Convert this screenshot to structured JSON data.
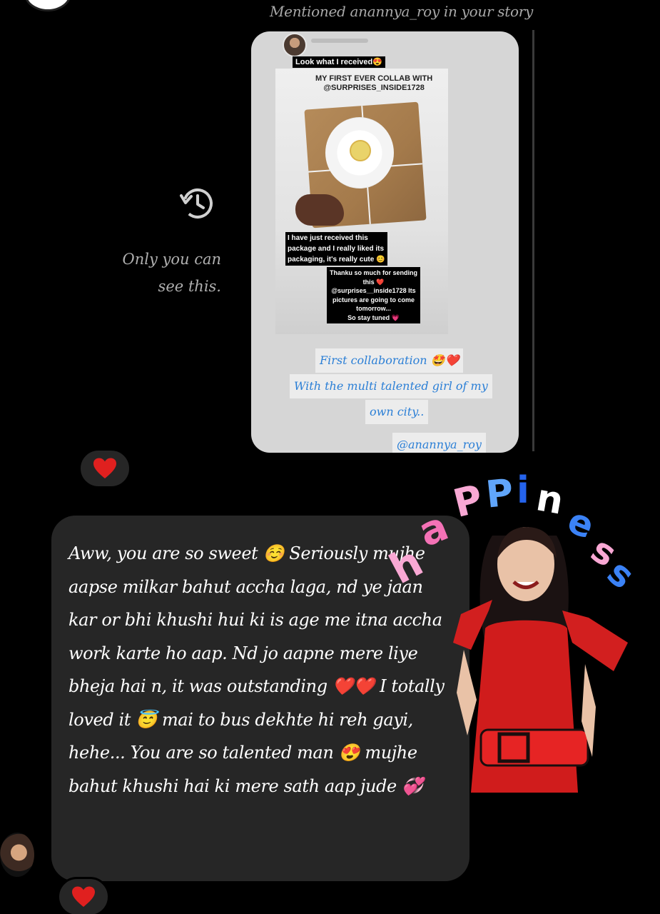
{
  "header": {
    "mention_text": "Mentioned anannya_roy in your story"
  },
  "privacy_note": {
    "text": "Only you can see this."
  },
  "story_card": {
    "label_look": "Look what I received😍",
    "label_collab": "MY FIRST EVER COLLAB WITH\n@SURPRISES_INSIDE1728",
    "label_received": "I have just received this\npackage and I really liked its\npackaging, it's really cute 😊",
    "label_thanks": "Thanku so much for sending\nthis ❤️\n@surprises__inside1728 Its\npictures are going to come\ntomorrow...\nSo stay tuned 💗",
    "caption_lines": [
      "First collaboration 🤩❤️",
      "With the multi talented girl of my",
      "own city..",
      "@anannya_roy"
    ]
  },
  "reactions": {
    "first": "heart",
    "second": "heart"
  },
  "message": {
    "text": "Aww, you are so sweet ☺️ Seriously mujhe aapse milkar bahut accha laga, nd ye jaan kar or bhi khushi hui ki is age me itna accha work karte ho aap. Nd jo aapne mere liye bheja hai n, it was outstanding ❤️❤️ I totally loved it 😇 mai to bus dekhte hi reh gayi, hehe... You are so talented man 😍 mujhe bahut khushi hai ki mere sath aap jude 💞"
  },
  "sticker": {
    "word": "happiness",
    "letter_colors": [
      "#f9a8d4",
      "#f472b6",
      "#f9a8d4",
      "#60a5fa",
      "#2563eb",
      "#ffffff",
      "#3b82f6",
      "#f9a8d4",
      "#3b82f6"
    ]
  },
  "colors": {
    "background": "#000000",
    "bubble": "#262626",
    "heart": "#e0201f",
    "caption_blue": "#2b7fd6"
  }
}
